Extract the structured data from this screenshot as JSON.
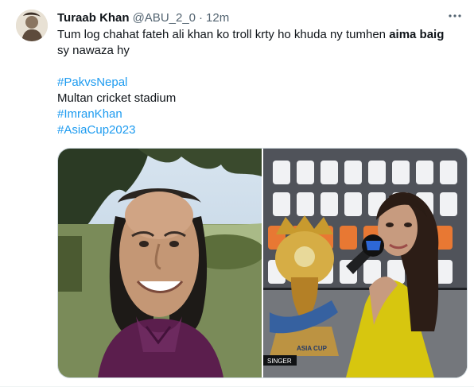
{
  "tweet": {
    "author_name": "Turaab Khan",
    "handle": "@ABU_2_0",
    "separator": "·",
    "timestamp": "12m",
    "text_line1_start": "Tum log chahat fateh ali khan ko troll krty ho khuda ny tumhen ",
    "text_line1_bold": "aima baig",
    "text_line2": "sy nawaza hy",
    "hashtag1": "#PakvsNepal",
    "location_line": "Multan cricket stadium",
    "hashtag2": "#ImranKhan",
    "hashtag3": "#AsiaCup2023"
  },
  "media": {
    "photo2_caption": "SINGER",
    "trophy_text": "ASIA CUP"
  },
  "icons": {
    "more": "more-horizontal-icon"
  },
  "colors": {
    "text": "#0f1419",
    "secondary": "#536471",
    "link": "#1d9bf0",
    "border": "#cfd9de"
  }
}
